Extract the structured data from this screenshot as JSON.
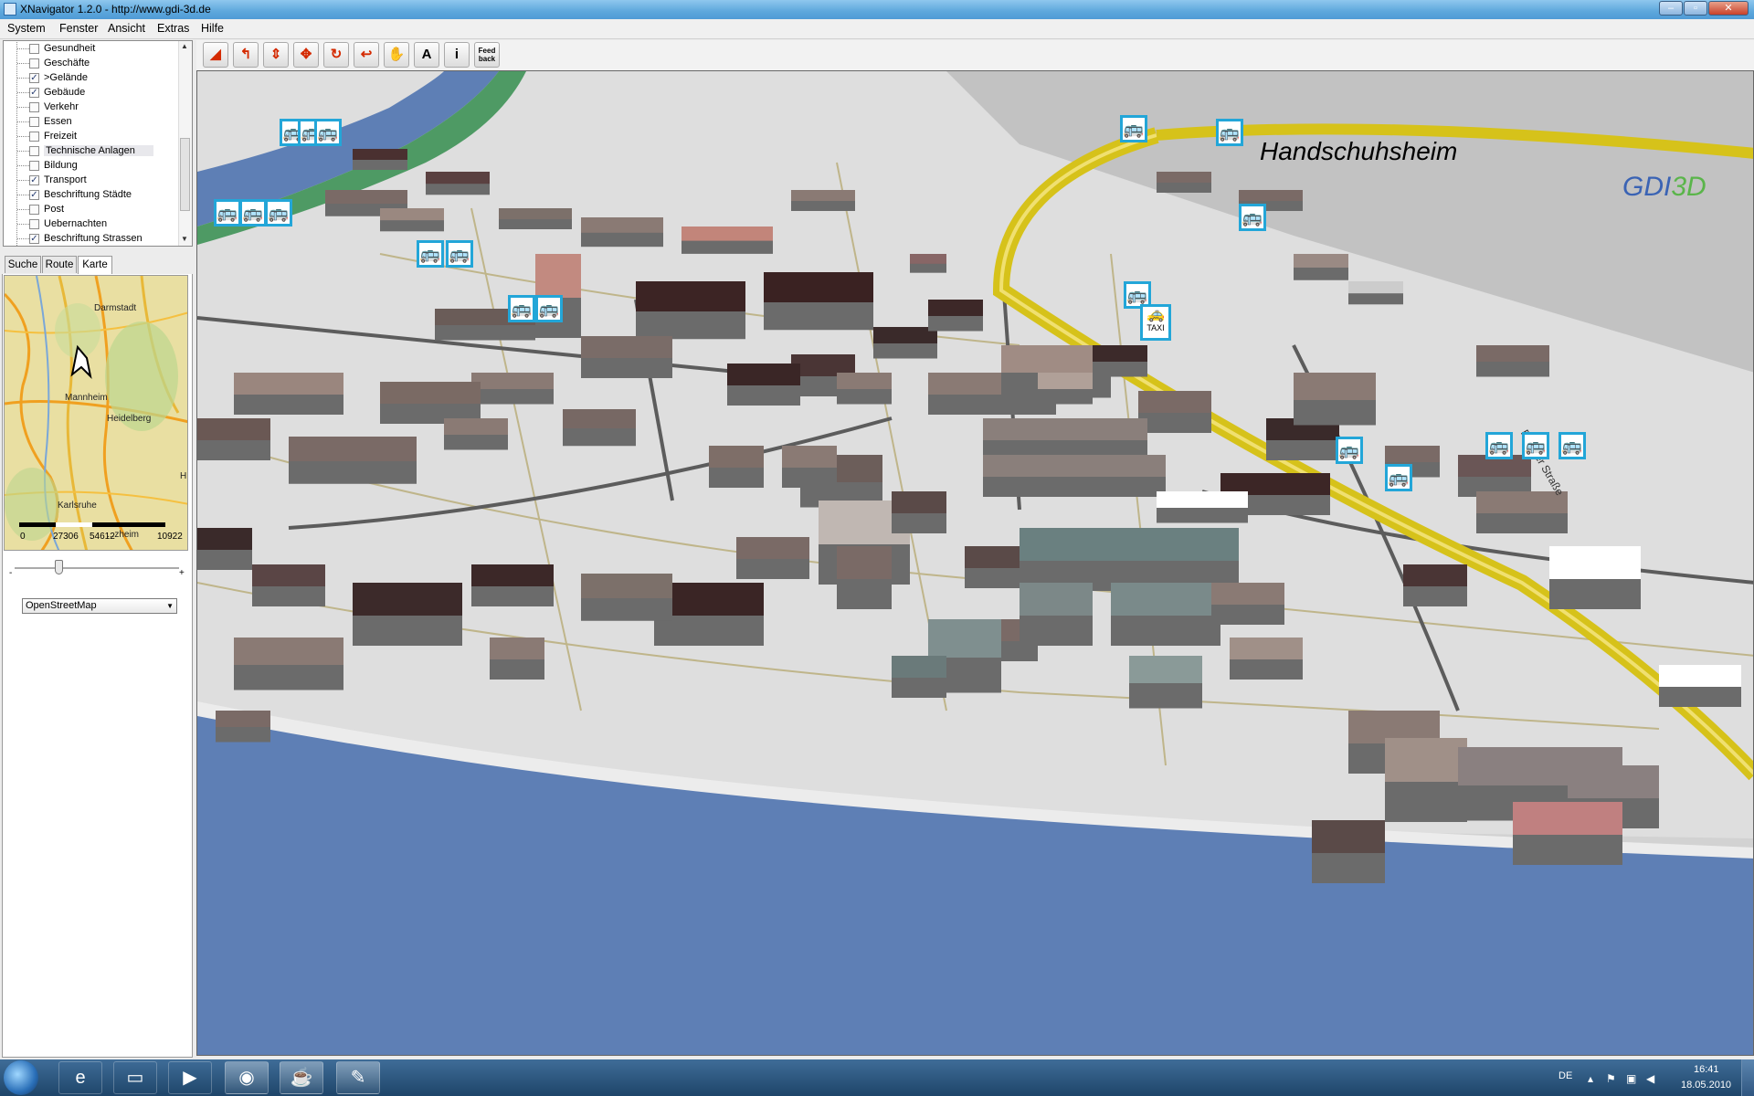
{
  "window": {
    "title": "XNavigator 1.2.0 - http://www.gdi-3d.de",
    "minimize_icon": "minimize-icon",
    "maximize_icon": "maximize-icon",
    "close_icon": "close-icon"
  },
  "menubar": {
    "items": [
      "System",
      "Fenster",
      "Ansicht",
      "Extras",
      "Hilfe"
    ]
  },
  "layers": {
    "items": [
      {
        "label": "Gesundheit",
        "checked": false
      },
      {
        "label": "Geschäfte",
        "checked": false
      },
      {
        "label": ">Gelände",
        "checked": true
      },
      {
        "label": "Gebäude",
        "checked": true
      },
      {
        "label": "Verkehr",
        "checked": false
      },
      {
        "label": "Essen",
        "checked": false
      },
      {
        "label": "Freizeit",
        "checked": false
      },
      {
        "label": "Technische Anlagen",
        "checked": false
      },
      {
        "label": "Bildung",
        "checked": false
      },
      {
        "label": "Transport",
        "checked": true
      },
      {
        "label": "Beschriftung Städte",
        "checked": true
      },
      {
        "label": "Post",
        "checked": false
      },
      {
        "label": "Uebernachten",
        "checked": false
      },
      {
        "label": "Beschriftung Strassen",
        "checked": true
      }
    ],
    "selected_index": 7,
    "check_mark": "✓"
  },
  "tabs": {
    "items": [
      "Suche",
      "Route",
      "Karte"
    ],
    "active": "Karte"
  },
  "minimap": {
    "labels": {
      "darmstadt": "Darmstadt",
      "mannheim": "Mannheim",
      "heidelberg": "Heidelberg",
      "karlsruhe": "Karlsruhe",
      "edge_h": "H",
      "lower_fragment": "...zheim"
    },
    "scale": [
      "0",
      "27306",
      "54612",
      "10922"
    ],
    "zoom_minus": "-",
    "zoom_plus": "+",
    "map_source": "OpenStreetMap",
    "dropdown_icon": "▼"
  },
  "toolbar": {
    "tools": [
      {
        "name": "navigate-mode-icon",
        "glyph": "◢"
      },
      {
        "name": "turn-icon",
        "glyph": "↰"
      },
      {
        "name": "move-up-down-icon",
        "glyph": "⇕"
      },
      {
        "name": "pan-icon",
        "glyph": "✥"
      },
      {
        "name": "rotate-icon",
        "glyph": "↻"
      },
      {
        "name": "back-icon",
        "glyph": "↩"
      },
      {
        "name": "hand-icon",
        "glyph": "✋"
      },
      {
        "name": "annotation-icon",
        "glyph": "A"
      },
      {
        "name": "info-icon",
        "glyph": "i"
      }
    ],
    "feedback_label": "Feed back"
  },
  "view3d": {
    "district_label": "Handschuhsheim",
    "logo_text_blue": "GDI",
    "logo_text_green": "3D",
    "street_label": "Berliner Straße",
    "bus_glyph": "🚌",
    "taxi_text": "TAXI",
    "taxi_glyph": "🚕"
  },
  "taskbar": {
    "start_icon": "windows-start-icon",
    "items": [
      {
        "name": "ie-icon",
        "glyph": "e",
        "open": false
      },
      {
        "name": "explorer-icon",
        "glyph": "▭",
        "open": false
      },
      {
        "name": "media-player-icon",
        "glyph": "▶",
        "open": false
      },
      {
        "name": "firefox-icon",
        "glyph": "◉",
        "open": true
      },
      {
        "name": "java-icon",
        "glyph": "☕",
        "open": true
      },
      {
        "name": "paint-icon",
        "glyph": "✎",
        "open": true
      }
    ],
    "language": "DE",
    "time": "16:41",
    "date": "18.05.2010"
  },
  "colors": {
    "water": "#5e7fb5",
    "terrain": "#dcdcdc",
    "highway": "#d6c21a",
    "bus_border": "#23a6d8"
  }
}
